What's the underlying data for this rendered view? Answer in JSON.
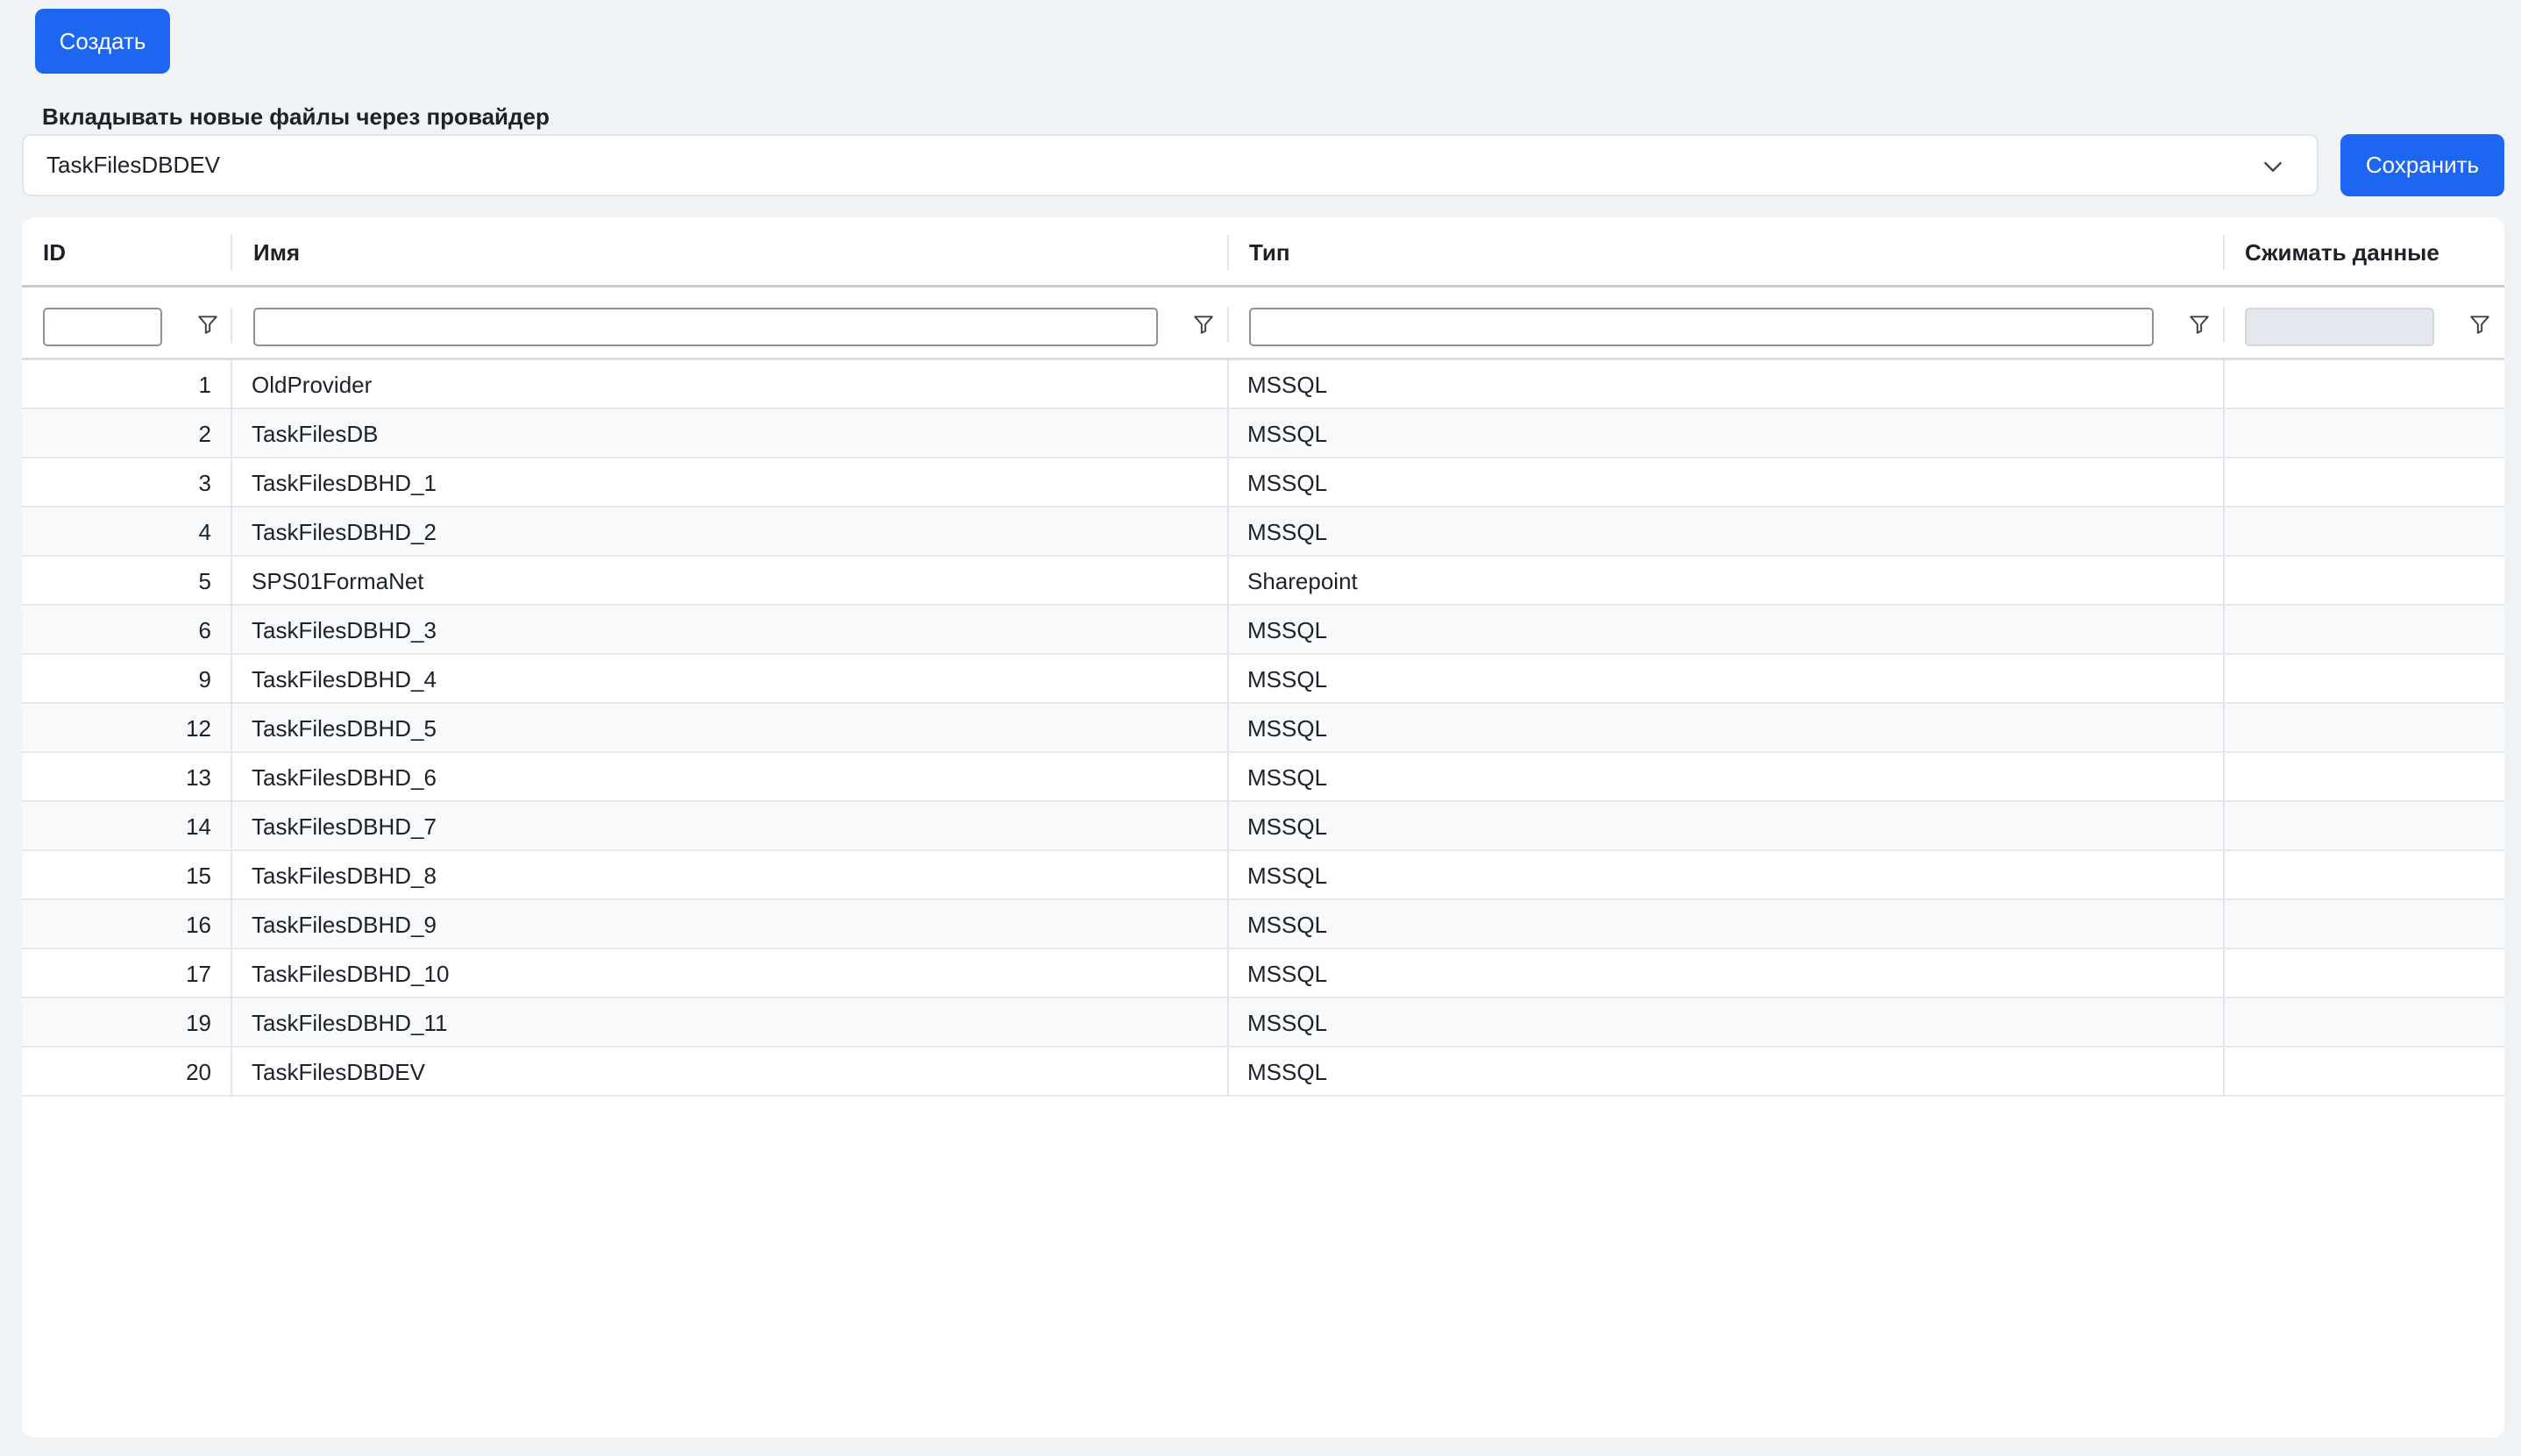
{
  "toolbar": {
    "create_label": "Создать"
  },
  "provider": {
    "label": "Вкладывать новые файлы через провайдер",
    "selected": "TaskFilesDBDEV",
    "save_label": "Сохранить"
  },
  "grid": {
    "columns": [
      "ID",
      "Имя",
      "Тип",
      "Сжимать данные"
    ],
    "rows": [
      {
        "id": "1",
        "name": "OldProvider",
        "type": "MSSQL"
      },
      {
        "id": "2",
        "name": "TaskFilesDB",
        "type": "MSSQL"
      },
      {
        "id": "3",
        "name": "TaskFilesDBHD_1",
        "type": "MSSQL"
      },
      {
        "id": "4",
        "name": "TaskFilesDBHD_2",
        "type": "MSSQL"
      },
      {
        "id": "5",
        "name": "SPS01FormaNet",
        "type": "Sharepoint"
      },
      {
        "id": "6",
        "name": "TaskFilesDBHD_3",
        "type": "MSSQL"
      },
      {
        "id": "9",
        "name": "TaskFilesDBHD_4",
        "type": "MSSQL"
      },
      {
        "id": "12",
        "name": "TaskFilesDBHD_5",
        "type": "MSSQL"
      },
      {
        "id": "13",
        "name": "TaskFilesDBHD_6",
        "type": "MSSQL"
      },
      {
        "id": "14",
        "name": "TaskFilesDBHD_7",
        "type": "MSSQL"
      },
      {
        "id": "15",
        "name": "TaskFilesDBHD_8",
        "type": "MSSQL"
      },
      {
        "id": "16",
        "name": "TaskFilesDBHD_9",
        "type": "MSSQL"
      },
      {
        "id": "17",
        "name": "TaskFilesDBHD_10",
        "type": "MSSQL"
      },
      {
        "id": "19",
        "name": "TaskFilesDBHD_11",
        "type": "MSSQL"
      },
      {
        "id": "20",
        "name": "TaskFilesDBDEV",
        "type": "MSSQL"
      }
    ]
  },
  "colors": {
    "accent": "#1c66f2",
    "background": "#f0f3f6"
  },
  "icons": {
    "select": "chevron-down-icon",
    "filter": "filter-icon"
  }
}
